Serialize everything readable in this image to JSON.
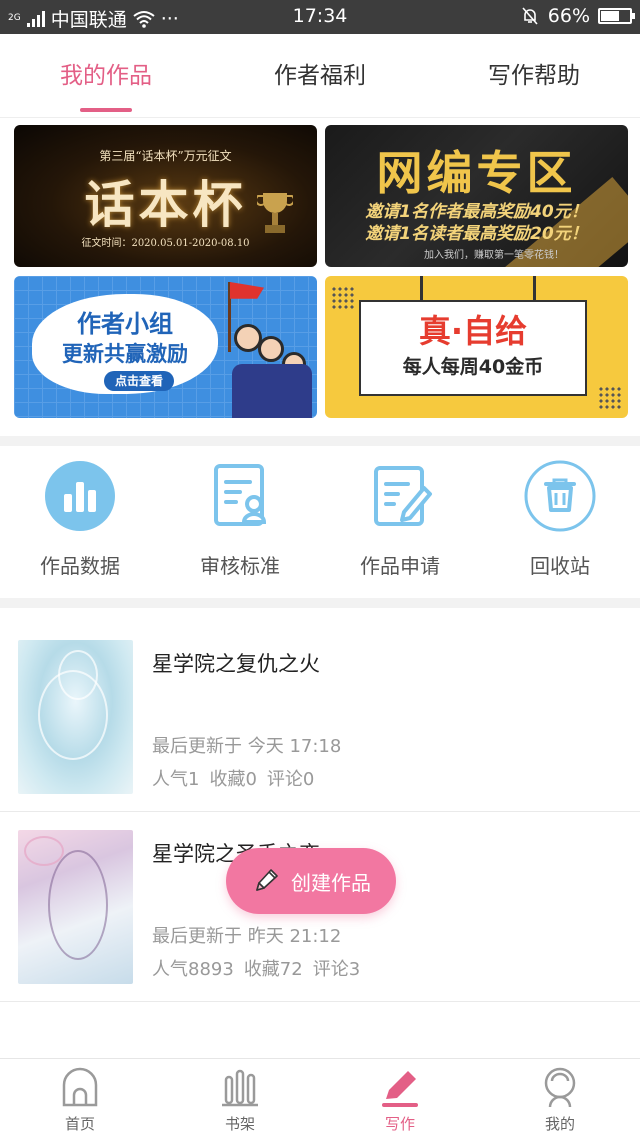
{
  "status_bar": {
    "network": "2G",
    "carrier": "中国联通",
    "more": "···",
    "time": "17:34",
    "battery": "66%",
    "battery_level": 0.66
  },
  "tabs": [
    {
      "label": "我的作品",
      "active": true
    },
    {
      "label": "作者福利",
      "active": false
    },
    {
      "label": "写作帮助",
      "active": false
    }
  ],
  "banners": {
    "b1": {
      "line1": "第三届“话本杯”万元征文",
      "line2": "话本杯",
      "line3": "征文时间：2020.05.01-2020-08.10"
    },
    "b2": {
      "line1": "网编专区",
      "line2": "邀请1名作者最高奖励40元！",
      "line3": "邀请1名读者最高奖励20元！",
      "line4": "加入我们，赚取第一笔零花钱！"
    },
    "b3": {
      "line1": "作者小组",
      "line2": "更新共赢激励",
      "button": "点击查看"
    },
    "b4": {
      "line1": "真·自给",
      "line2": "每人每周40金币"
    }
  },
  "quick_actions": [
    {
      "label": "作品数据",
      "icon": "bar-chart-icon"
    },
    {
      "label": "审核标准",
      "icon": "review-doc-icon"
    },
    {
      "label": "作品申请",
      "icon": "edit-doc-icon"
    },
    {
      "label": "回收站",
      "icon": "trash-icon"
    }
  ],
  "works": [
    {
      "title": "星学院之复仇之火",
      "updated": "最后更新于 今天 17:18",
      "popularity": "人气1",
      "favorites": "收藏0",
      "comments": "评论0"
    },
    {
      "title": "星学院之圣手之恋",
      "updated": "最后更新于 昨天 21:12",
      "popularity": "人气8893",
      "favorites": "收藏72",
      "comments": "评论3"
    }
  ],
  "fab": {
    "label": "创建作品",
    "icon": "pencil-icon"
  },
  "bottom_nav": [
    {
      "label": "首页",
      "icon": "home-icon",
      "active": false
    },
    {
      "label": "书架",
      "icon": "bookshelf-icon",
      "active": false
    },
    {
      "label": "写作",
      "icon": "write-icon",
      "active": true
    },
    {
      "label": "我的",
      "icon": "profile-icon",
      "active": false
    }
  ],
  "colors": {
    "accent": "#e35f86",
    "fab": "#f277a1",
    "icon_blue": "#7cc4ec"
  }
}
